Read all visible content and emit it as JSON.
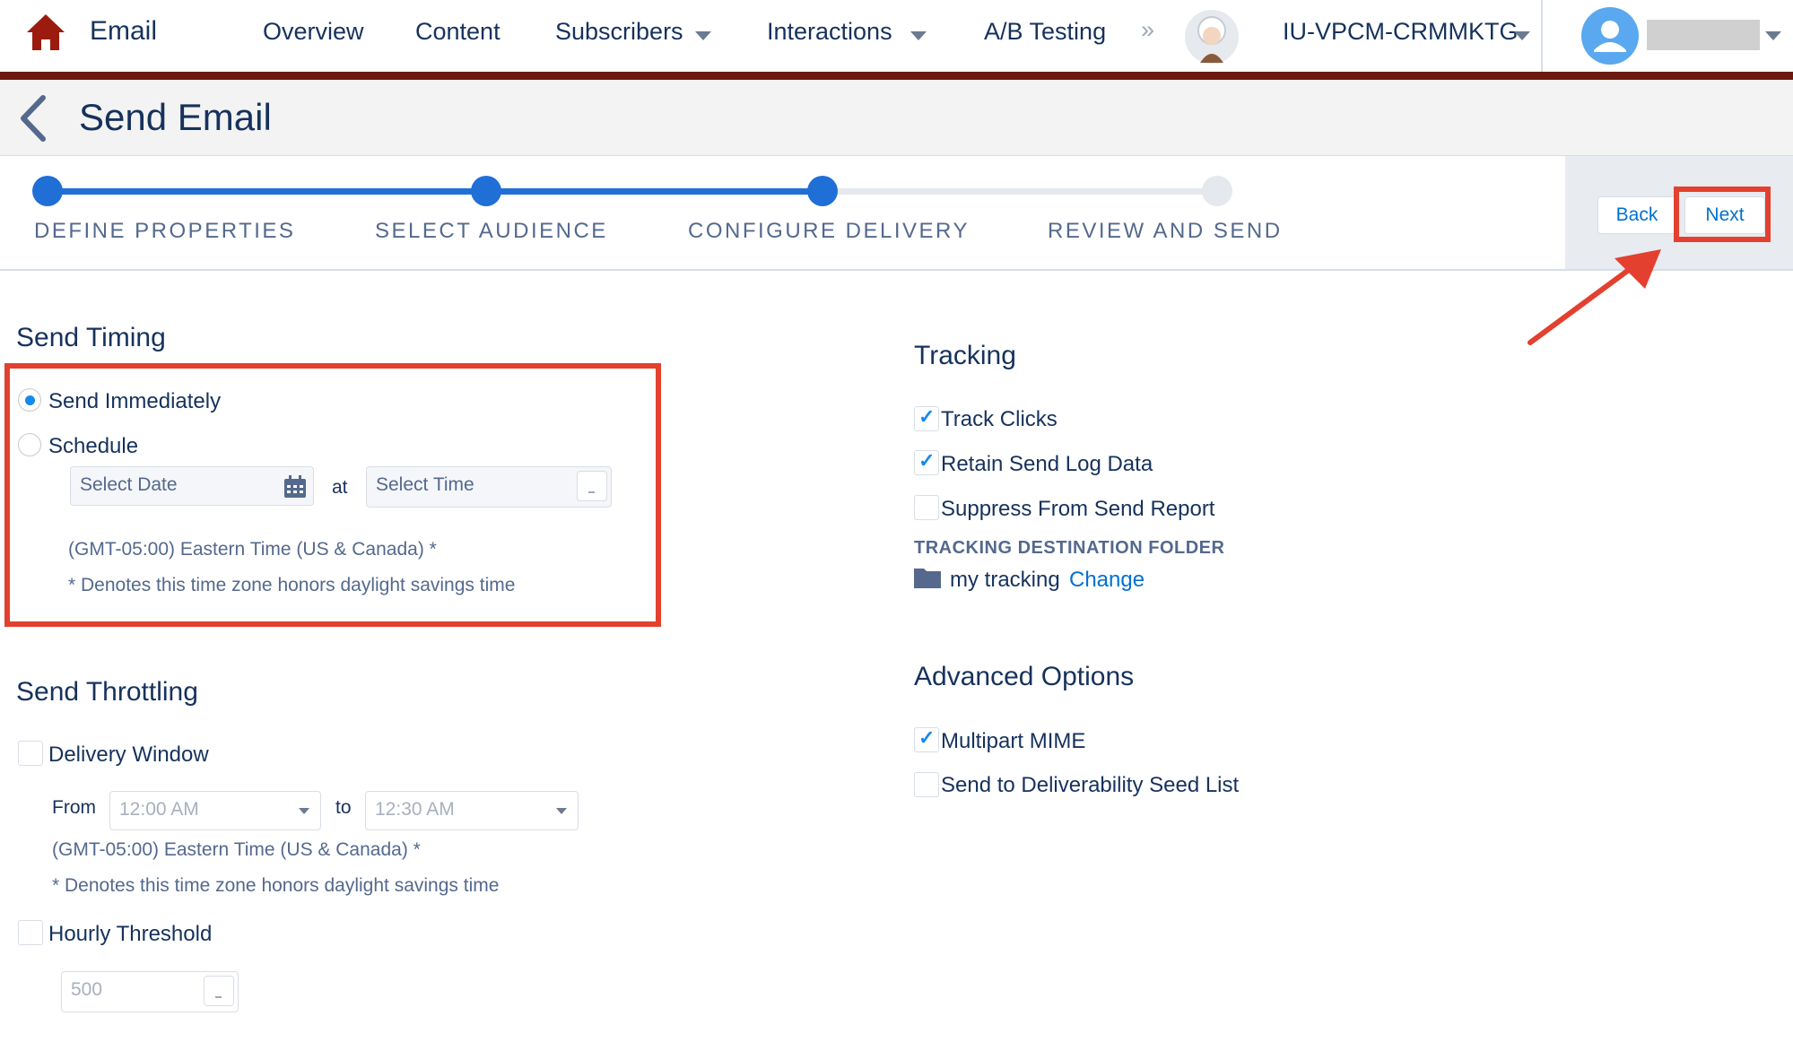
{
  "nav": {
    "app_name": "Email",
    "items": [
      {
        "label": "Overview"
      },
      {
        "label": "Content"
      },
      {
        "label": "Subscribers"
      },
      {
        "label": "Interactions"
      },
      {
        "label": "A/B Testing"
      }
    ],
    "overflow": "»",
    "account": "IU-VPCM-CRMMKTG"
  },
  "header": {
    "title": "Send Email"
  },
  "steps": [
    {
      "label": "DEFINE PROPERTIES",
      "state": "complete"
    },
    {
      "label": "SELECT AUDIENCE",
      "state": "complete"
    },
    {
      "label": "CONFIGURE DELIVERY",
      "state": "current"
    },
    {
      "label": "REVIEW AND SEND",
      "state": "upcoming"
    }
  ],
  "buttons": {
    "back": "Back",
    "next": "Next"
  },
  "send_timing": {
    "title": "Send Timing",
    "send_immediately": "Send Immediately",
    "schedule": "Schedule",
    "date_placeholder": "Select Date",
    "at": "at",
    "time_placeholder": "Select Time",
    "timezone": "(GMT-05:00) Eastern Time (US & Canada) *",
    "dst_note": "* Denotes this time zone honors daylight savings time"
  },
  "send_throttling": {
    "title": "Send Throttling",
    "delivery_window": "Delivery Window",
    "from_label": "From",
    "from_value": "12:00 AM",
    "to_label": "to",
    "to_value": "12:30 AM",
    "timezone": "(GMT-05:00) Eastern Time (US & Canada) *",
    "dst_note": "* Denotes this time zone honors daylight savings time",
    "hourly_threshold": "Hourly Threshold",
    "threshold_value": "500"
  },
  "tracking": {
    "title": "Tracking",
    "track_clicks": "Track Clicks",
    "retain_log": "Retain Send Log Data",
    "suppress_report": "Suppress From Send Report",
    "folder_label": "TRACKING DESTINATION FOLDER",
    "folder_name": "my tracking",
    "change": "Change"
  },
  "advanced": {
    "title": "Advanced Options",
    "multipart": "Multipart MIME",
    "seed_list": "Send to Deliverability Seed List"
  },
  "colors": {
    "brand_dark": "#6b1a10",
    "accent": "#1f6fd6",
    "annotation": "#e3402f",
    "text": "#16325c"
  }
}
